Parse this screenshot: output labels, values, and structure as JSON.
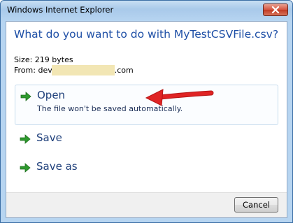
{
  "window": {
    "title": "Windows Internet Explorer"
  },
  "dialog": {
    "heading": "What do you want to do with MyTestCSVFile.csv?",
    "size_label": "Size: 219 bytes",
    "from_prefix": "From: dev",
    "from_suffix": ".com"
  },
  "options": [
    {
      "label": "Open",
      "description": "The file won't be saved automatically.",
      "icon": "green-arrow-icon"
    },
    {
      "label": "Save",
      "icon": "green-arrow-icon"
    },
    {
      "label": "Save as",
      "icon": "green-arrow-icon"
    }
  ],
  "footer": {
    "cancel_label": "Cancel"
  },
  "colors": {
    "heading": "#1e4fa6",
    "arrow_green": "#2e9a2e",
    "annotation_red": "#d81d1d"
  }
}
